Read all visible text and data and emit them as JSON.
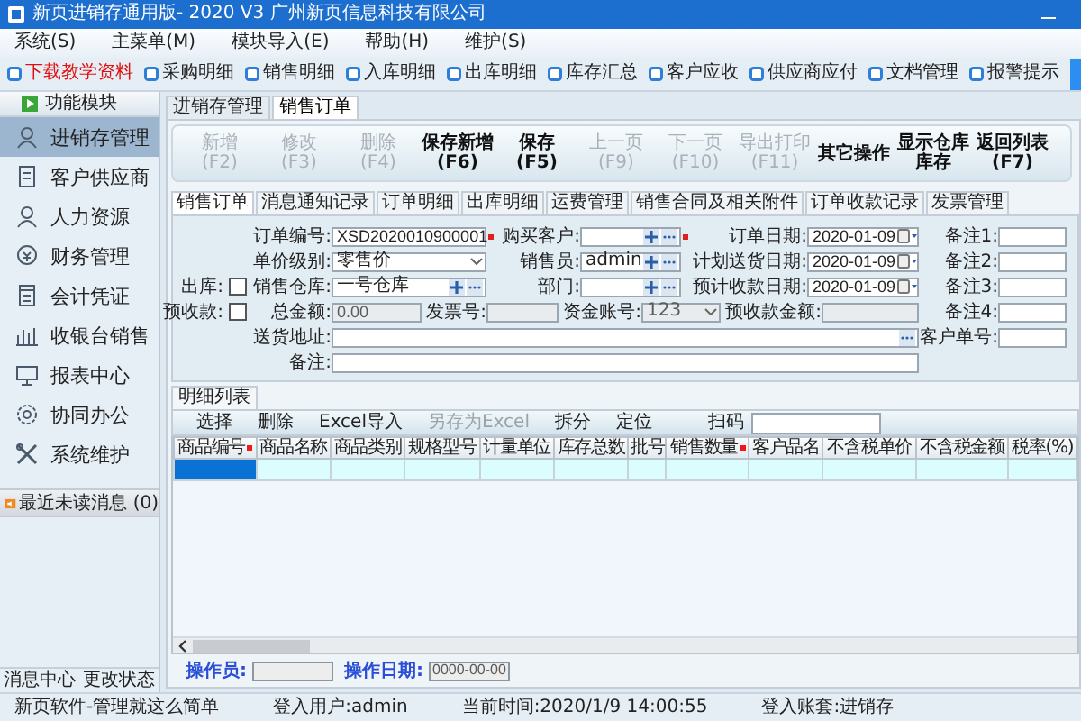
{
  "window": {
    "title": "新页进销存通用版- 2020 V3 广州新页信息科技有限公司"
  },
  "menu": [
    "系统(S)",
    "主菜单(M)",
    "模块导入(E)",
    "帮助(H)",
    "维护(S)"
  ],
  "quick_links": [
    {
      "label": "下载教学资料",
      "highlighted": true
    },
    {
      "label": "采购明细",
      "highlighted": false
    },
    {
      "label": "销售明细",
      "highlighted": false
    },
    {
      "label": "入库明细",
      "highlighted": false
    },
    {
      "label": "出库明细",
      "highlighted": false
    },
    {
      "label": "库存汇总",
      "highlighted": false
    },
    {
      "label": "客户应收",
      "highlighted": false
    },
    {
      "label": "供应商应付",
      "highlighted": false
    },
    {
      "label": "文档管理",
      "highlighted": false
    },
    {
      "label": "报警提示",
      "highlighted": false
    }
  ],
  "sidebar": {
    "title": "功能模块",
    "items": [
      {
        "label": "进销存管理",
        "selected": true
      },
      {
        "label": "客户供应商",
        "selected": false
      },
      {
        "label": "人力资源",
        "selected": false
      },
      {
        "label": "财务管理",
        "selected": false
      },
      {
        "label": "会计凭证",
        "selected": false
      },
      {
        "label": "收银台销售",
        "selected": false
      },
      {
        "label": "报表中心",
        "selected": false
      },
      {
        "label": "协同办公",
        "selected": false
      },
      {
        "label": "系统维护",
        "selected": false
      }
    ],
    "messages": "最近未读消息 (0)",
    "footer": [
      "消息中心",
      "更改状态"
    ]
  },
  "tabs": [
    {
      "label": "进销存管理",
      "selected": false
    },
    {
      "label": "销售订单",
      "selected": true
    }
  ],
  "toolbar": [
    {
      "label": "新增",
      "key": "(F2)",
      "disabled": true
    },
    {
      "label": "修改",
      "key": "(F3)",
      "disabled": true
    },
    {
      "label": "删除",
      "key": "(F4)",
      "disabled": true
    },
    {
      "label": "保存新增",
      "key": "(F6)",
      "disabled": false
    },
    {
      "label": "保存",
      "key": "(F5)",
      "disabled": false
    },
    {
      "label": "上一页",
      "key": "(F9)",
      "disabled": true
    },
    {
      "label": "下一页",
      "key": "(F10)",
      "disabled": true
    },
    {
      "label": "导出打印",
      "key": "(F11)",
      "disabled": true
    },
    {
      "label": "其它操作",
      "disabled": false
    },
    {
      "label": "显示仓库库存",
      "disabled": false
    },
    {
      "label": "返回列表",
      "key": "(F7)",
      "disabled": false
    }
  ],
  "form": {
    "tabs": [
      {
        "label": "销售订单",
        "selected": true
      },
      {
        "label": "消息通知记录",
        "selected": false
      },
      {
        "label": "订单明细",
        "selected": false
      },
      {
        "label": "出库明细",
        "selected": false
      },
      {
        "label": "运费管理",
        "selected": false
      },
      {
        "label": "销售合同及相关附件",
        "selected": false
      },
      {
        "label": "订单收款记录",
        "selected": false
      },
      {
        "label": "发票管理",
        "selected": false
      }
    ],
    "rows": [
      {
        "fields": [
          {
            "label": "订单编号:",
            "kind": "text",
            "value": "XSD2020010900001",
            "required": true
          },
          {
            "label": "购买客户:",
            "kind": "lookup",
            "required": true
          },
          {
            "label": "订单日期:",
            "kind": "date",
            "value": "2020-01-09"
          }
        ]
      },
      {
        "fields": [
          {
            "label": "单价级别:",
            "kind": "select",
            "value": "零售价"
          },
          {
            "label": "销售员:",
            "kind": "lookup",
            "value": "admin"
          },
          {
            "label": "计划送货日期:",
            "kind": "date",
            "value": "2020-01-09"
          }
        ]
      },
      {
        "check": {
          "label": "出库:",
          "checked": false
        },
        "fields": [
          {
            "label": "销售仓库:",
            "kind": "lookup",
            "value": "一号仓库"
          },
          {
            "label": "部门:",
            "kind": "lookup"
          },
          {
            "label": "预计收款日期:",
            "kind": "date",
            "value": "2020-01-09"
          }
        ]
      },
      {
        "check": {
          "label": "预收款:",
          "checked": false
        },
        "fields": [
          {
            "label": "总金额:",
            "kind": "text",
            "value": "0.00",
            "disabled": true
          },
          {
            "label": "发票号:",
            "kind": "text",
            "disabled": true
          },
          {
            "label": "资金账号:",
            "kind": "select",
            "value": "123",
            "disabled": true
          },
          {
            "label": "预收款金额:",
            "kind": "text",
            "disabled": true
          }
        ]
      },
      {
        "fields": [
          {
            "label": "送货地址:",
            "kind": "browse"
          }
        ]
      },
      {
        "fields": [
          {
            "label": "备注:",
            "kind": "text",
            "disabled": false
          }
        ]
      }
    ],
    "side": [
      {
        "label": "备注1:"
      },
      {
        "label": "备注2:"
      },
      {
        "label": "备注3:"
      },
      {
        "label": "备注4:"
      },
      {
        "label": "客户单号:"
      }
    ]
  },
  "detail": {
    "tab": "明细列表",
    "actions": [
      {
        "label": "选择",
        "disabled": false
      },
      {
        "label": "删除",
        "disabled": false
      },
      {
        "label": "Excel导入",
        "disabled": false
      },
      {
        "label": "另存为Excel",
        "disabled": true
      },
      {
        "label": "拆分",
        "disabled": false
      },
      {
        "label": "定位",
        "disabled": false
      }
    ],
    "scan": {
      "label": "扫码"
    },
    "columns": [
      {
        "label": "商品编号",
        "required": true
      },
      {
        "label": "商品名称",
        "required": false
      },
      {
        "label": "商品类别",
        "required": false
      },
      {
        "label": "规格型号",
        "required": false
      },
      {
        "label": "计量单位",
        "required": false
      },
      {
        "label": "库存总数",
        "required": false
      },
      {
        "label": "批号",
        "required": false
      },
      {
        "label": "销售数量",
        "required": true
      },
      {
        "label": "客户品名",
        "required": false
      },
      {
        "label": "不含税单价",
        "required": false
      },
      {
        "label": "不含税金额",
        "required": false
      },
      {
        "label": "税率(%)",
        "required": false
      }
    ],
    "rows": [
      {
        "cells": [
          {
            "selected": true
          },
          {
            "selected": false
          },
          {
            "selected": false
          },
          {
            "selected": false
          },
          {
            "selected": false
          },
          {
            "selected": false
          },
          {
            "selected": false
          },
          {
            "selected": false
          },
          {
            "selected": false
          },
          {
            "selected": false
          },
          {
            "selected": false
          },
          {
            "selected": false
          }
        ]
      }
    ]
  },
  "footer_fields": [
    {
      "label": "操作员:"
    },
    {
      "label": "操作日期:",
      "value": "0000-00-00"
    }
  ],
  "status_bar": [
    "新页软件-管理就这么简单",
    "登入用户:admin",
    "当前时间:2020/1/9 14:00:55",
    "登入账套:进销存"
  ]
}
